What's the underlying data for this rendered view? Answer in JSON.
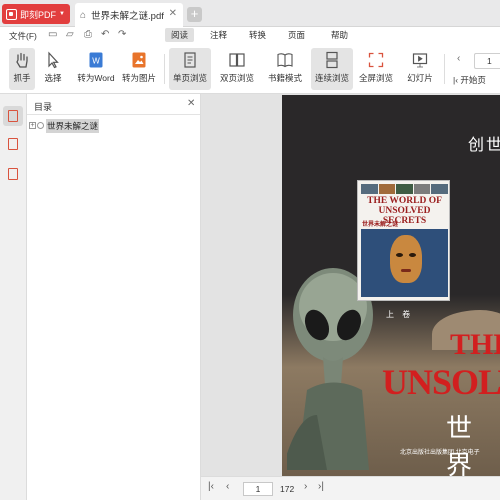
{
  "app": {
    "brand_label": "即刻PDF",
    "tab_title": "世界未解之谜.pdf"
  },
  "menu": {
    "file": "文件(F)",
    "items": [
      "阅读",
      "注释",
      "转换",
      "页面",
      "帮助"
    ],
    "active": "阅读"
  },
  "toolbar": {
    "tools": [
      {
        "label": "抓手",
        "icon": "hand-icon"
      },
      {
        "label": "选择",
        "icon": "cursor-icon"
      },
      {
        "label": "转为Word",
        "icon": "word-icon"
      },
      {
        "label": "转为图片",
        "icon": "image-icon"
      },
      {
        "label": "单页浏览",
        "icon": "single-page-icon"
      },
      {
        "label": "双页浏览",
        "icon": "double-page-icon"
      },
      {
        "label": "书籍模式",
        "icon": "book-icon"
      },
      {
        "label": "连续浏览",
        "icon": "continuous-icon"
      },
      {
        "label": "全屏浏览",
        "icon": "fullscreen-icon"
      },
      {
        "label": "幻灯片",
        "icon": "slideshow-icon"
      }
    ],
    "page_input": "1",
    "first_page_label": "开始页"
  },
  "outline": {
    "title": "目录",
    "items": [
      {
        "label": "世界未解之谜"
      }
    ]
  },
  "cover": {
    "top_text": "创世",
    "book_title_en": "THE WORLD OF UNSOLVED SECRETS",
    "book_title_cn": "世界未解之谜",
    "volume": "上 卷",
    "big_title_1": "THE",
    "big_title_2": "UNSOLV",
    "big_title_cn": "世 界",
    "publisher": "北京出版社出版集团 北京电子"
  },
  "status": {
    "current_page": "1",
    "total_pages": "172"
  },
  "colors": {
    "brand": "#e23e3e",
    "accent_word": "#3a7bd5",
    "accent_image": "#e8742b",
    "title_red": "#d21f1f"
  }
}
